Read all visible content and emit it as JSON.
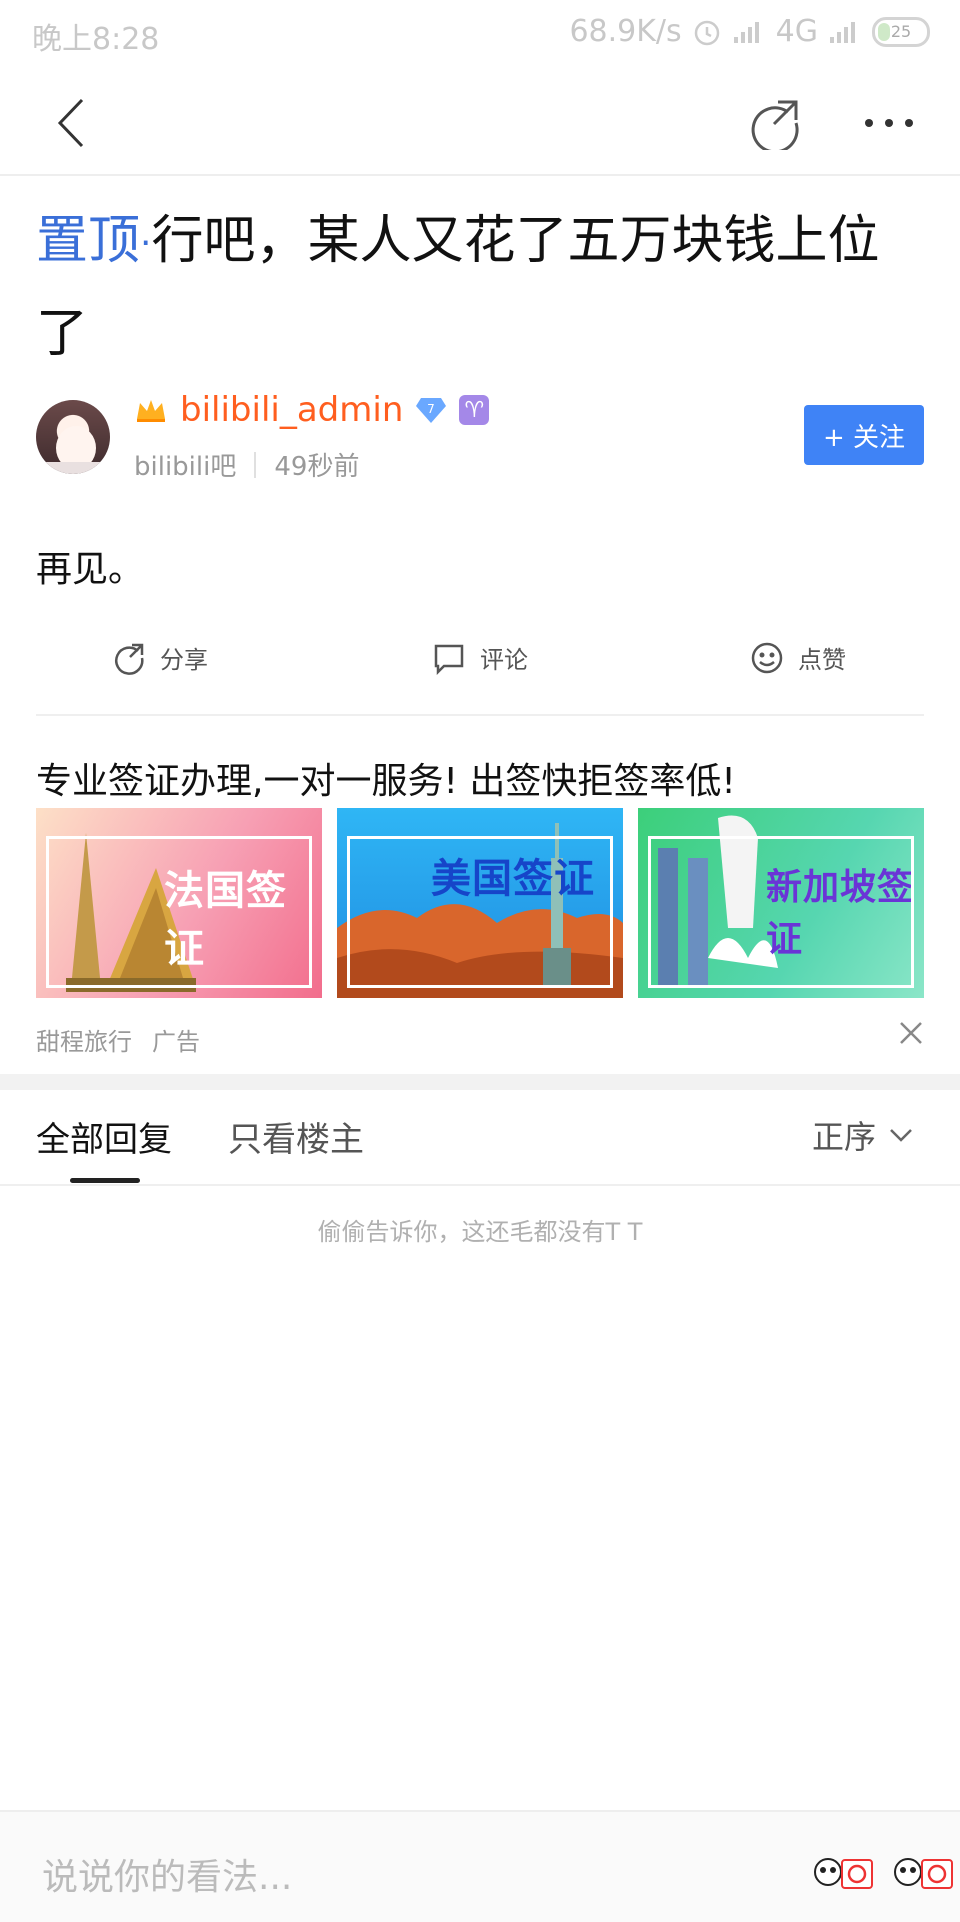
{
  "status_bar": {
    "time": "晚上8:28",
    "network_speed": "68.9K/s",
    "network_type": "4G",
    "battery": "25"
  },
  "post": {
    "pin_label": "置顶",
    "title": "行吧，某人又花了五万块钱上位了",
    "author": {
      "name": "bilibili_admin",
      "level": "7",
      "zodiac": "♈",
      "forum": "bilibili吧",
      "time": "49秒前"
    },
    "follow_label": "+ 关注",
    "content": "再见。"
  },
  "actions": {
    "share": "分享",
    "comment": "评论",
    "like": "点赞"
  },
  "ad": {
    "title": "专业签证办理,一对一服务! 出签快拒签率低!",
    "images": [
      {
        "label": "法国签证",
        "bg": "#f6a3a3"
      },
      {
        "label": "美国签证",
        "bg": "#2aa8f0"
      },
      {
        "label": "新加坡签证",
        "bg": "#3ed18f"
      }
    ],
    "advertiser": "甜程旅行",
    "ad_tag": "广告"
  },
  "replies": {
    "tab_all": "全部回复",
    "tab_op": "只看楼主",
    "sort": "正序",
    "empty_text": "偷偷告诉你，这还毛都没有T T"
  },
  "composer": {
    "placeholder": "说说你的看法..."
  },
  "colors": {
    "accent_blue": "#3f83f6",
    "username_orange": "#ff5e1f",
    "pin_blue": "#3a6fd8"
  }
}
